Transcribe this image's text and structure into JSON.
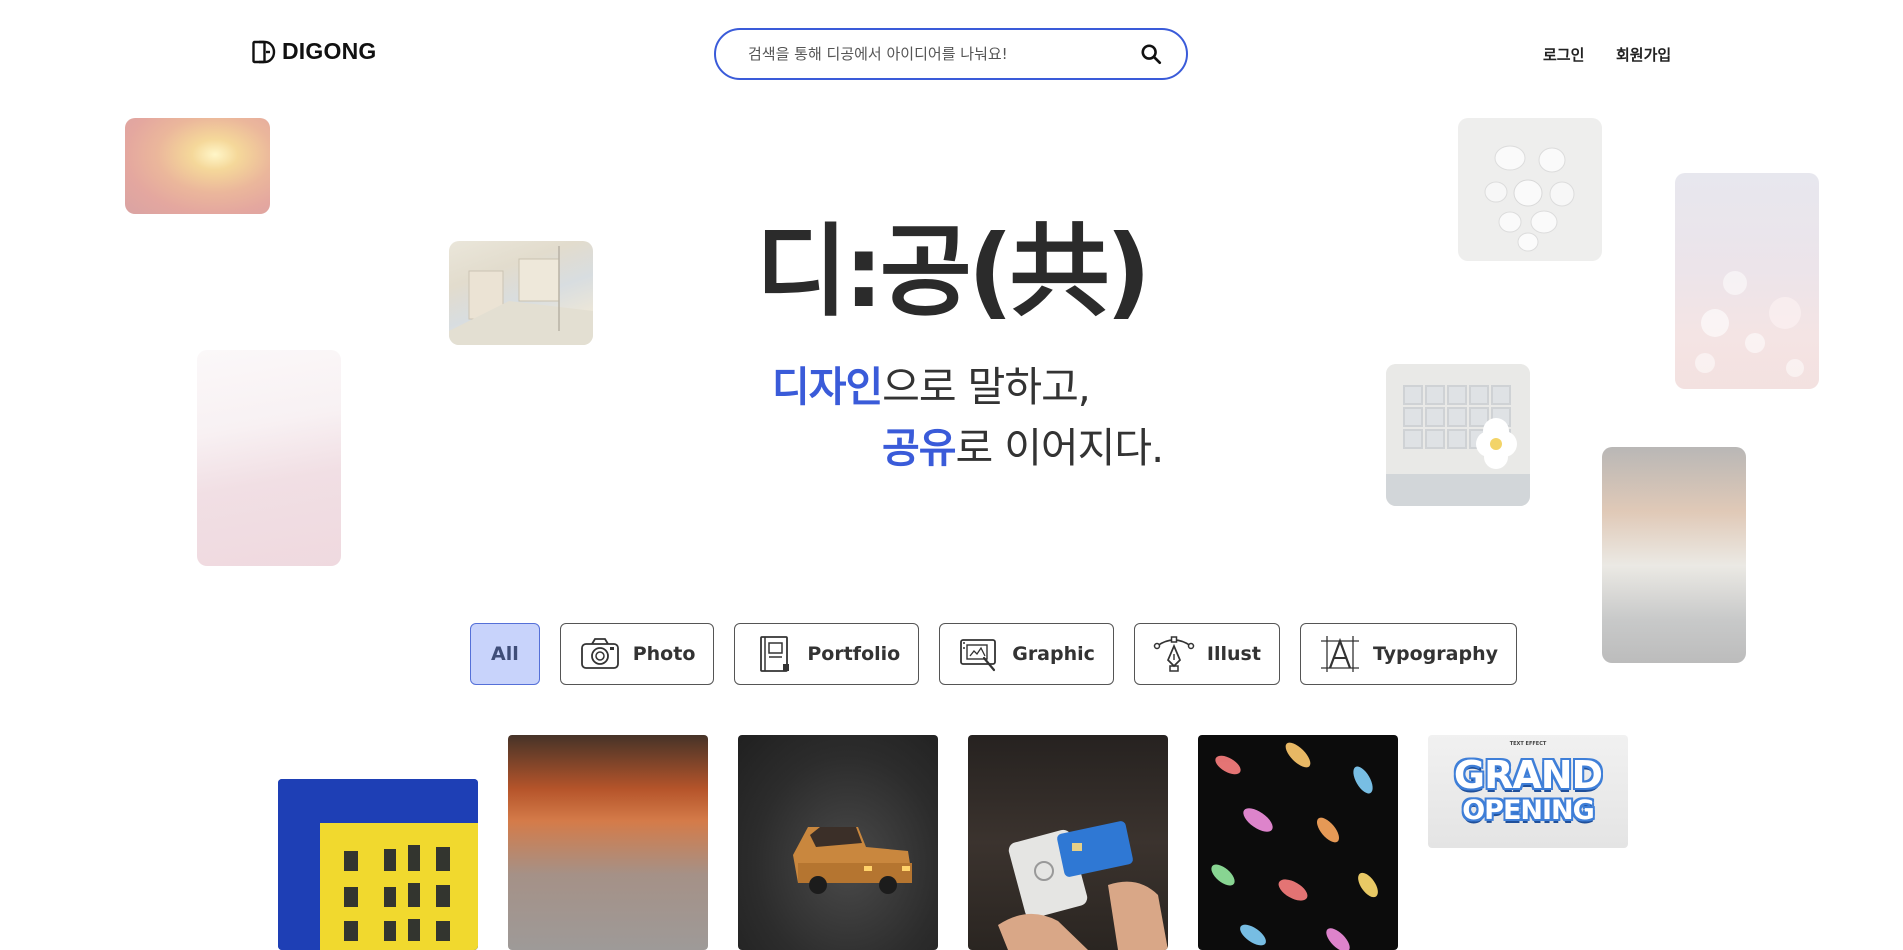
{
  "header": {
    "logo_text": "DIGONG",
    "search_placeholder": "검색을 통해 디공에서 아이디어를 나눠요!",
    "login_label": "로그인",
    "signup_label": "회원가입"
  },
  "hero": {
    "title": "디:공(共)",
    "line1_highlight": "디자인",
    "line1_rest": "으로 말하고,",
    "line2_highlight": "공유",
    "line2_rest": "로 이어지다."
  },
  "categories": [
    {
      "label": "All",
      "icon": "",
      "active": true
    },
    {
      "label": "Photo",
      "icon": "camera-icon",
      "active": false
    },
    {
      "label": "Portfolio",
      "icon": "portfolio-book-icon",
      "active": false
    },
    {
      "label": "Graphic",
      "icon": "graphic-tablet-icon",
      "active": false
    },
    {
      "label": "Illust",
      "icon": "pen-tool-icon",
      "active": false
    },
    {
      "label": "Typography",
      "icon": "typography-icon",
      "active": false
    }
  ],
  "gallery": {
    "grand_opening_small": "TEXT EFFECT",
    "grand_opening_line1": "GRAND",
    "grand_opening_line2": "OPENING"
  },
  "colors": {
    "accent": "#3a5bd9",
    "active_pill_bg": "#c8d3fb"
  }
}
